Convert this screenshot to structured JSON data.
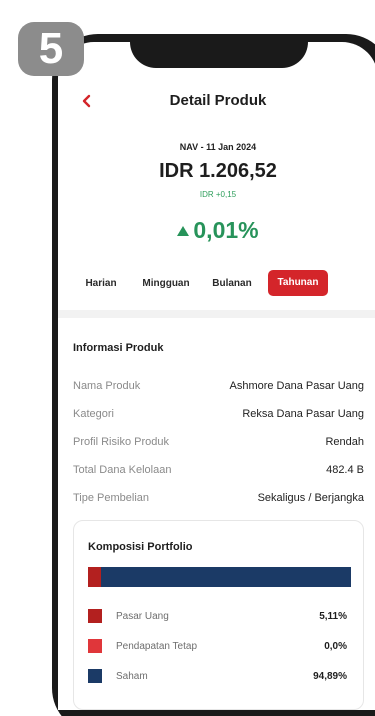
{
  "badge": {
    "step": "5"
  },
  "header": {
    "title": "Detail Produk",
    "back_icon": "chevron-left-icon"
  },
  "nav": {
    "date": "NAV - 11 Jan 2024",
    "price": "IDR 1.206,52",
    "change": "IDR +0,15",
    "percent": "0,01%",
    "trend_icon": "triangle-up-icon",
    "color_positive": "#27935a"
  },
  "periods": [
    "Harian",
    "Mingguan",
    "Bulanan",
    "Tahunan"
  ],
  "active_period": "Tahunan",
  "accent": "#d4252a",
  "info": {
    "title": "Informasi Produk",
    "rows": [
      {
        "label": "Nama Produk",
        "value": "Ashmore Dana Pasar Uang"
      },
      {
        "label": "Kategori",
        "value": "Reksa Dana Pasar Uang"
      },
      {
        "label": "Profil Risiko Produk",
        "value": "Rendah"
      },
      {
        "label": "Total Dana Kelolaan",
        "value": "482.4 B"
      },
      {
        "label": "Tipe Pembelian",
        "value": "Sekaligus / Berjangka"
      }
    ]
  },
  "portfolio": {
    "title": "Komposisi Portfolio",
    "items": [
      {
        "label": "Pasar Uang",
        "value": "5,11%",
        "share": 5.11,
        "color": "#b3201f"
      },
      {
        "label": "Pendapatan Tetap",
        "value": "0,0%",
        "share": 0.0,
        "color": "#e0363a"
      },
      {
        "label": "Saham",
        "value": "94,89%",
        "share": 94.89,
        "color": "#1b3a66"
      }
    ]
  }
}
